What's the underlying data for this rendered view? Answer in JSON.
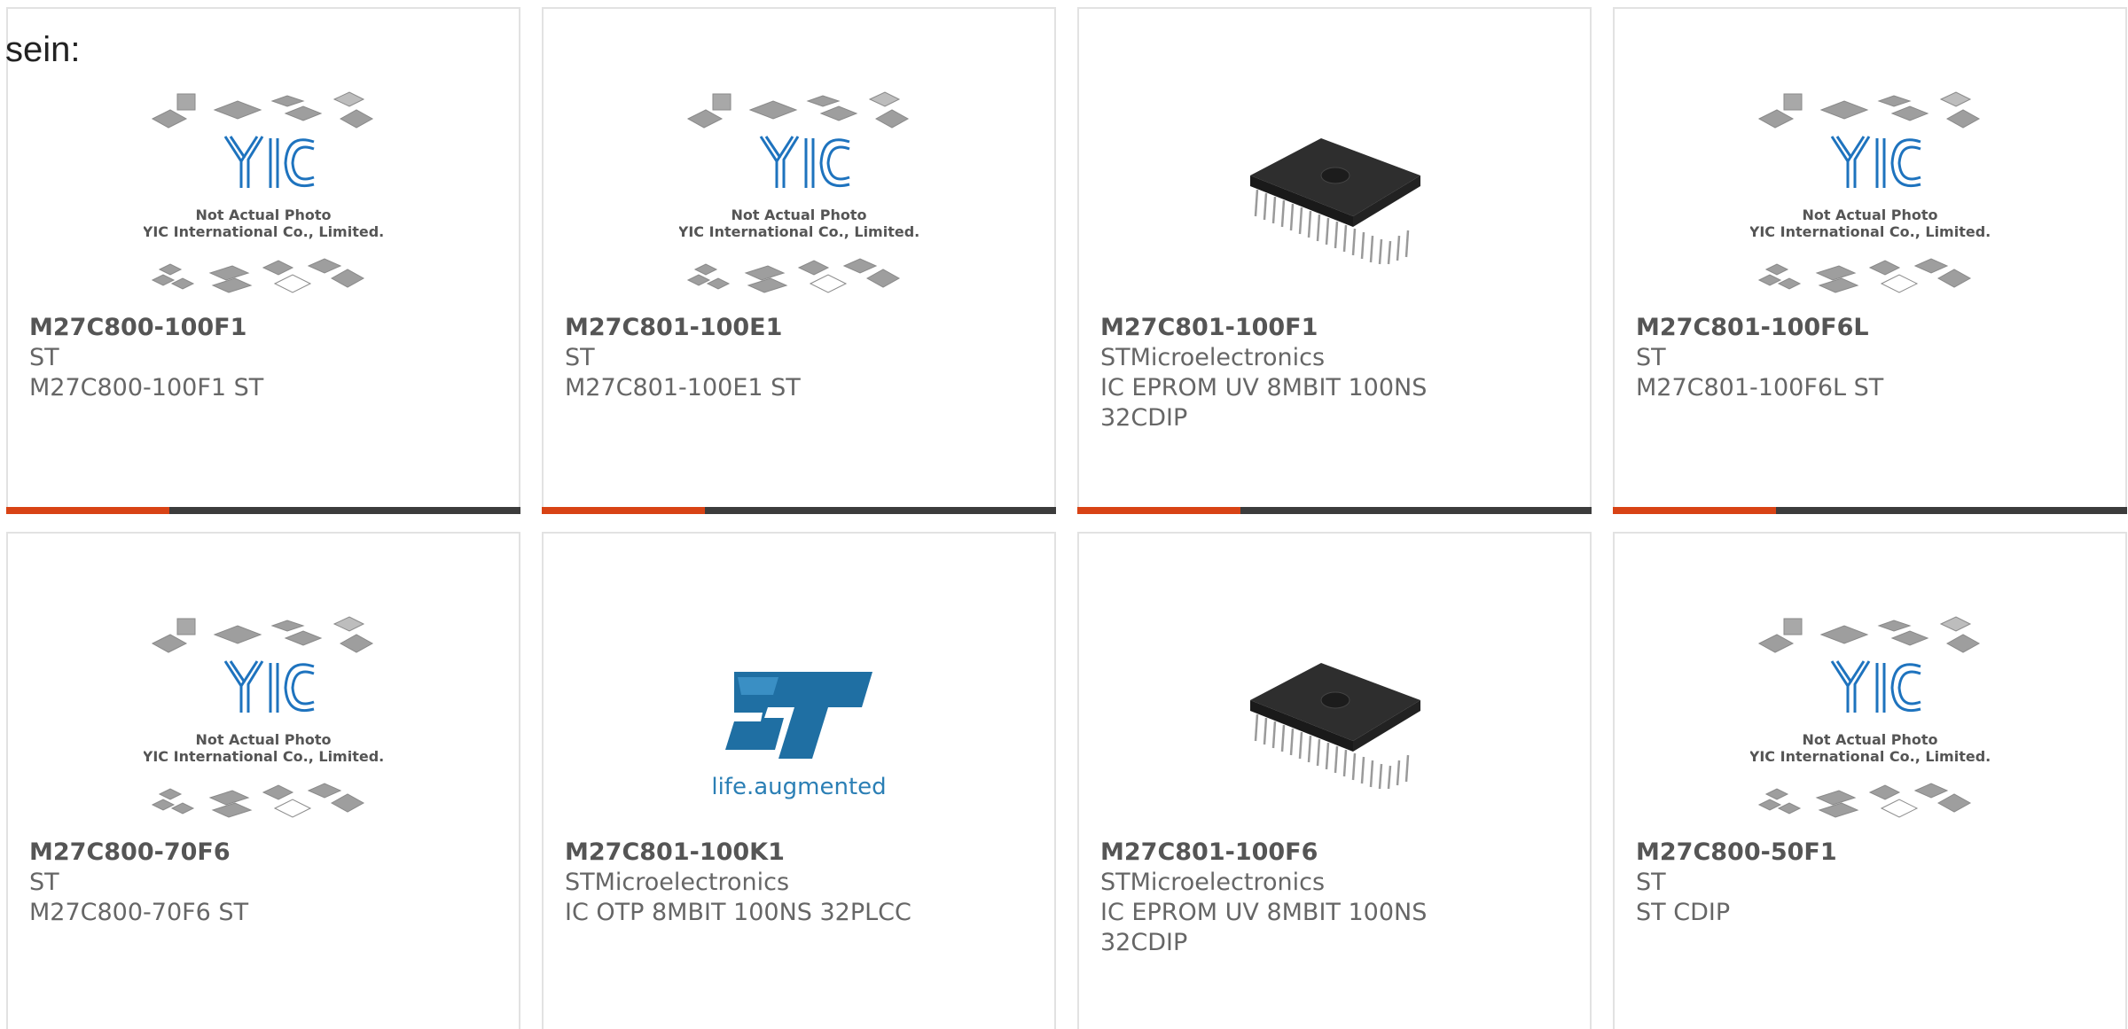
{
  "intro": {
    "text": "sein:"
  },
  "colors": {
    "bar_accent": "#d84315",
    "bar_dark": "#3c3c3c",
    "st_blue": "#1f6fa3"
  },
  "placeholder": {
    "caption_line1": "Not Actual Photo",
    "caption_line2": "YIC International Co., Limited."
  },
  "st_logo": {
    "tagline": "life.augmented"
  },
  "products": [
    {
      "part_number": "M27C800-100F1",
      "manufacturer": "ST",
      "description_lines": [
        "M27C800-100F1 ST"
      ],
      "image": "yic-placeholder-image"
    },
    {
      "part_number": "M27C801-100E1",
      "manufacturer": "ST",
      "description_lines": [
        "M27C801-100E1 ST"
      ],
      "image": "yic-placeholder-image"
    },
    {
      "part_number": "M27C801-100F1",
      "manufacturer": "STMicroelectronics",
      "description_lines": [
        "IC EPROM UV 8MBIT 100NS",
        "32CDIP"
      ],
      "image": "dip-chip-image"
    },
    {
      "part_number": "M27C801-100F6L",
      "manufacturer": "ST",
      "description_lines": [
        "M27C801-100F6L ST"
      ],
      "image": "yic-placeholder-image"
    },
    {
      "part_number": "M27C800-70F6",
      "manufacturer": "ST",
      "description_lines": [
        "M27C800-70F6 ST"
      ],
      "image": "yic-placeholder-image"
    },
    {
      "part_number": "M27C801-100K1",
      "manufacturer": "STMicroelectronics",
      "description_lines": [
        "IC OTP 8MBIT 100NS 32PLCC"
      ],
      "image": "st-logo-image"
    },
    {
      "part_number": "M27C801-100F6",
      "manufacturer": "STMicroelectronics",
      "description_lines": [
        "IC EPROM UV 8MBIT 100NS",
        "32CDIP"
      ],
      "image": "dip-chip-image"
    },
    {
      "part_number": "M27C800-50F1",
      "manufacturer": "ST",
      "description_lines": [
        "ST CDIP"
      ],
      "image": "yic-placeholder-image"
    }
  ]
}
